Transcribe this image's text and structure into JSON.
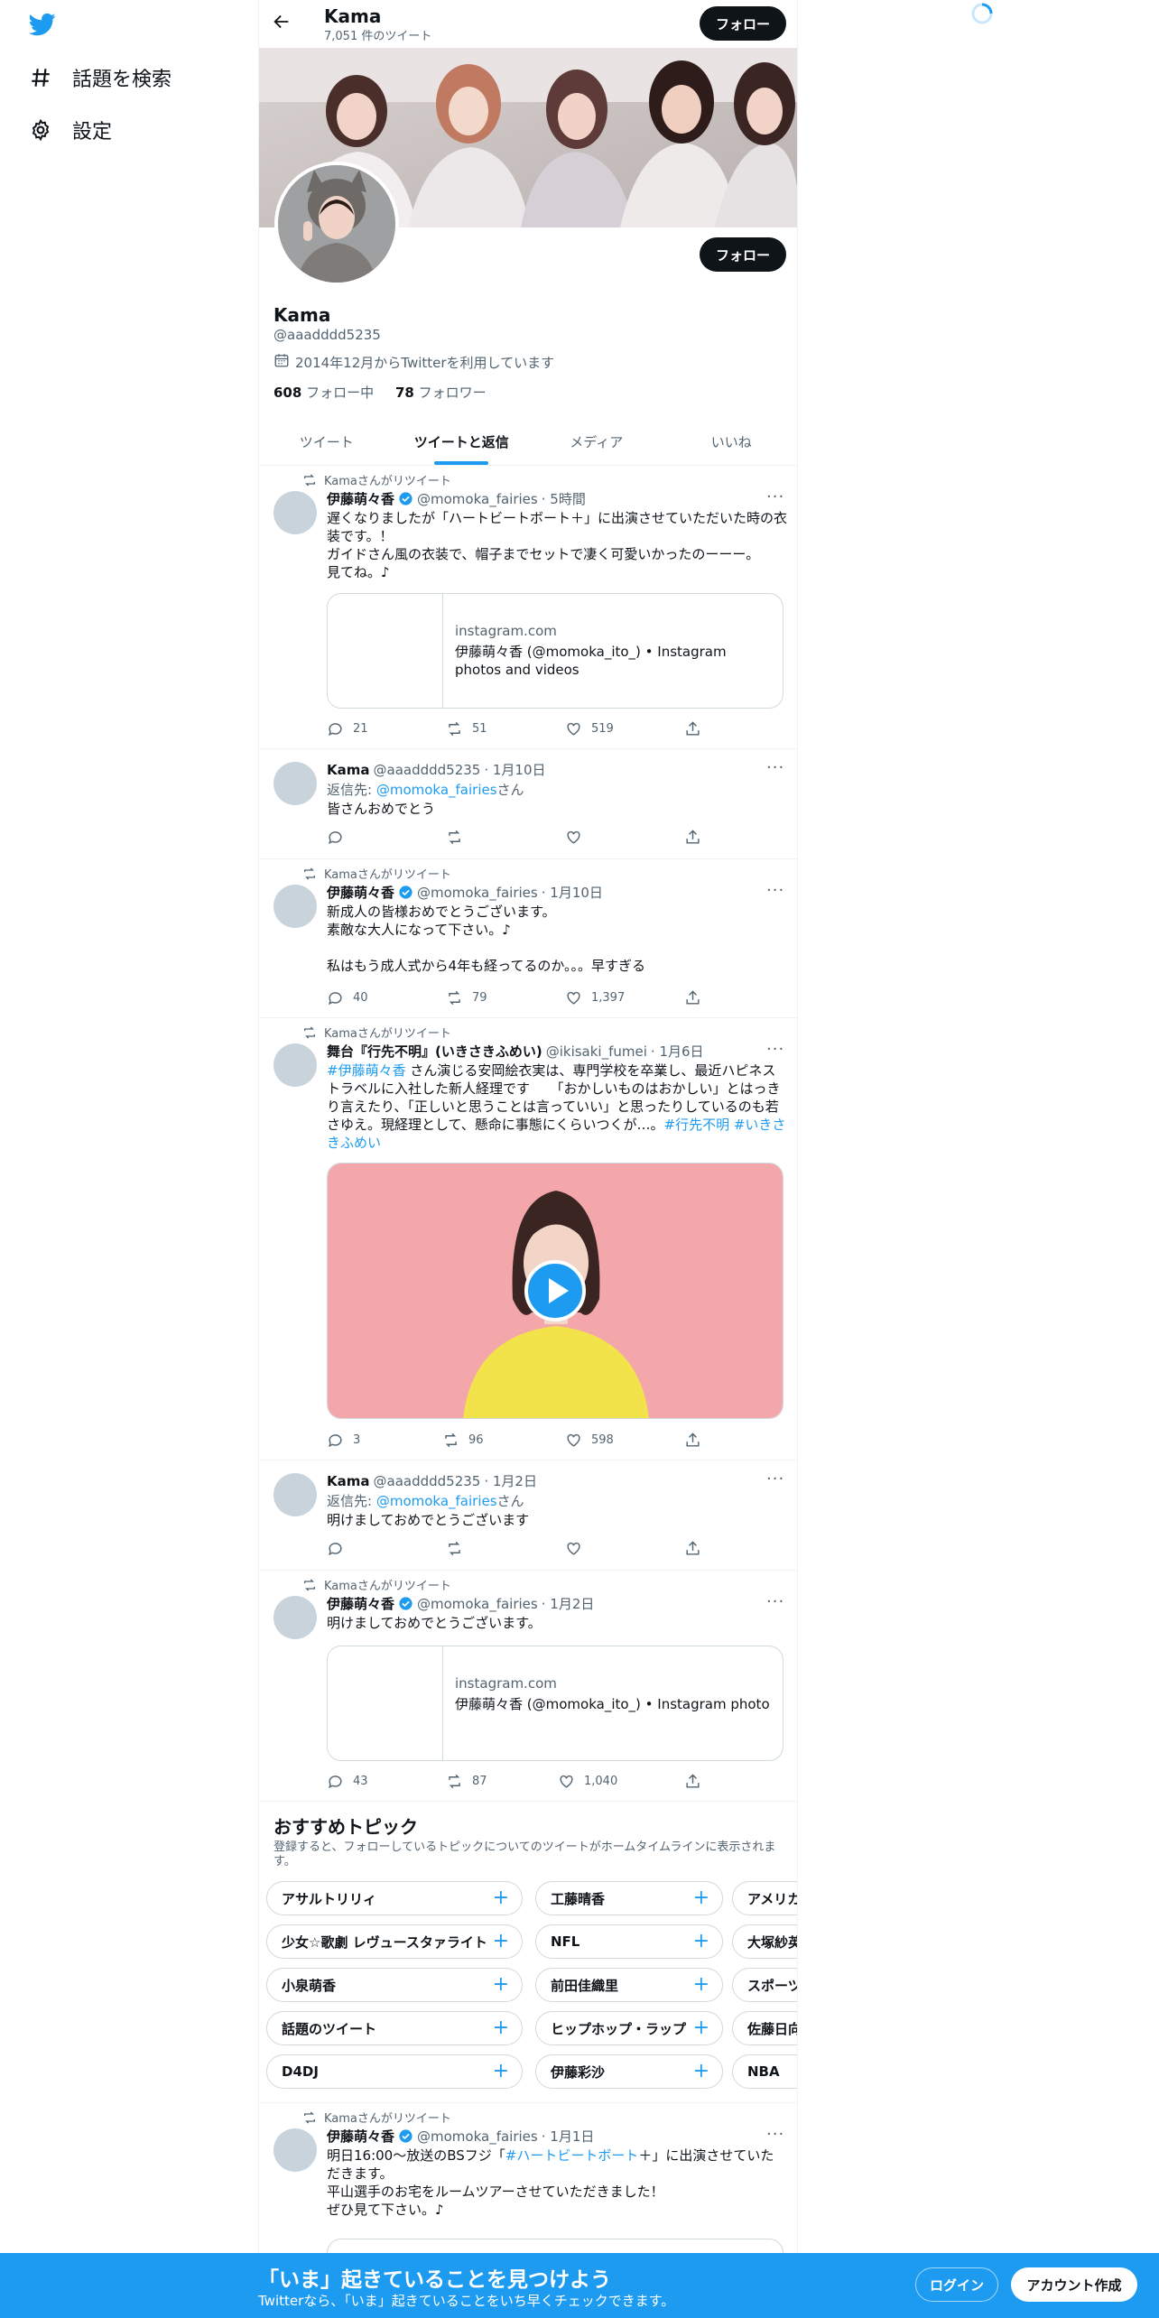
{
  "nav": {
    "explore_label": "話題を検索",
    "settings_label": "設定"
  },
  "header": {
    "name": "Kama",
    "tweet_count": "7,051 件のツイート",
    "follow_label": "フォロー"
  },
  "profile": {
    "name": "Kama",
    "handle": "@aaadddd5235",
    "joined": "2014年12月からTwitterを利用しています",
    "following_count": "608",
    "following_label": "フォロー中",
    "followers_count": "78",
    "followers_label": "フォロワー",
    "follow_label": "フォロー"
  },
  "tabs": [
    {
      "label": "ツイート"
    },
    {
      "label": "ツイートと返信"
    },
    {
      "label": "メディア"
    },
    {
      "label": "いいね"
    }
  ],
  "tweets": [
    {
      "retweet_label": "Kamaさんがリツイート",
      "name": "伊藤萌々香",
      "handle": "@momoka_fairies",
      "time": "· 5時間",
      "text": "遅くなりましたが「ハートビートボート＋」に出演させていただいた時の衣装です。！\nガイドさん風の衣装で、帽子までセットで凄く可愛いかったのーーー。\n見てね。♪",
      "card_domain": "instagram.com",
      "card_title": "伊藤萌々香 (@momoka_ito_) • Instagram photos and videos",
      "replies": "21",
      "retweets": "51",
      "likes": "519"
    },
    {
      "name": "Kama",
      "handle": "@aaadddd5235",
      "time": "· 1月10日",
      "reply_prefix": "返信先: ",
      "reply_user": "@momoka_fairies",
      "reply_suffix": "さん",
      "text": "皆さんおめでとう"
    },
    {
      "retweet_label": "Kamaさんがリツイート",
      "name": "伊藤萌々香",
      "handle": "@momoka_fairies",
      "time": "· 1月10日",
      "text": "新成人の皆様おめでとうございます。\n素敵な大人になって下さい。♪\n\n私はもう成人式から4年も経ってるのか。。。早すぎる",
      "replies": "40",
      "retweets": "79",
      "likes": "1,397"
    },
    {
      "retweet_label": "Kamaさんがリツイート",
      "name": "舞台『行先不明』(いきさきふめい)",
      "handle": "@ikisaki_fumei",
      "time": "· 1月6日",
      "hashtag1": "#伊藤萌々香",
      "text": " さん演じる安岡絵衣実は、専門学校を卒業し、最近ハピネストラベルに入社した新人経理です　　「おかしいものはおかしい」とはっきり言えたり、「正しいと思うことは言っていい」と思ったりしているのも若さゆえ。現経理として、懸命に事態にくらいつくが…。",
      "hashtags_end": "#行先不明 #いきさきふめい",
      "replies": "3",
      "retweets": "96",
      "likes": "598"
    },
    {
      "name": "Kama",
      "handle": "@aaadddd5235",
      "time": "· 1月2日",
      "reply_prefix": "返信先: ",
      "reply_user": "@momoka_fairies",
      "reply_suffix": "さん",
      "text": "明けましておめでとうございます"
    },
    {
      "retweet_label": "Kamaさんがリツイート",
      "name": "伊藤萌々香",
      "handle": "@momoka_fairies",
      "time": "· 1月2日",
      "text": "明けましておめでとうございます。",
      "card_domain": "instagram.com",
      "card_title": "伊藤萌々香 (@momoka_ito_) • Instagram photo",
      "replies": "43",
      "retweets": "87",
      "likes": "1,040"
    },
    {
      "retweet_label": "Kamaさんがリツイート",
      "name": "伊藤萌々香",
      "handle": "@momoka_fairies",
      "time": "· 1月1日",
      "text_before": "明日16:00〜放送のBSフジ「",
      "text_link": "#ハートビートボート",
      "text_after": "＋」に出演させていただきます。\n平山選手のお宅をルームツアーさせていただきました！\nぜひ見て下さい。♪"
    }
  ],
  "topics": {
    "title": "おすすめトピック",
    "subtitle": "登録すると、フォローしているトピックについてのツイートがホームタイムラインに表示されます。",
    "rows": [
      [
        "アサルトリリィ",
        "工藤晴香",
        "アメリカ"
      ],
      [
        "少女☆歌劇 レヴュースタァライト",
        "NFL",
        "大塚紗英"
      ],
      [
        "小泉萌香",
        "前田佳織里",
        "スポーツ"
      ],
      [
        "話題のツイート",
        "ヒップホップ・ラップ",
        "佐藤日向"
      ],
      [
        "D4DJ",
        "伊藤彩沙",
        "NBA"
      ]
    ]
  },
  "bottom": {
    "title": "「いま」起きていることを見つけよう",
    "subtitle": "Twitterなら、「いま」起きていることをいち早くチェックできます。",
    "login_label": "ログイン",
    "signup_label": "アカウント作成"
  },
  "colors": {
    "accent": "#1d9bf0",
    "text": "#0f1419",
    "muted": "#536471",
    "border": "#eff3f4"
  }
}
